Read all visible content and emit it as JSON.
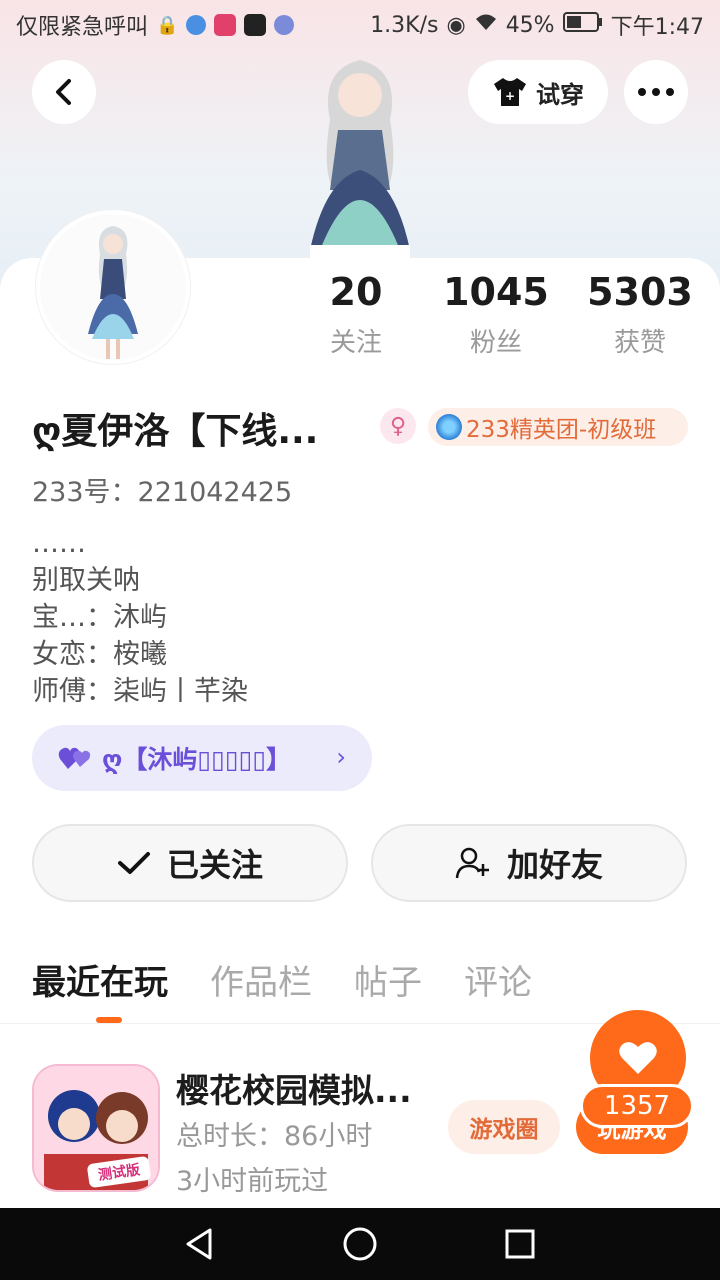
{
  "status_bar": {
    "carrier": "仅限紧急呼叫",
    "speed": "1.3K/s",
    "battery": "45%",
    "time": "下午1:47"
  },
  "header": {
    "tryon_label": "试穿"
  },
  "profile": {
    "stats": [
      {
        "value": "20",
        "label": "关注"
      },
      {
        "value": "1045",
        "label": "粉丝"
      },
      {
        "value": "5303",
        "label": "获赞"
      }
    ],
    "username": "ღ夏伊洛【下线...",
    "club_badge": "233精英团-初级班",
    "user_id": "233号：221042425",
    "bio": [
      "……",
      "别取关呐",
      "宝…：沐屿",
      "女恋：桉曦",
      "师傅：柒屿丨芊染"
    ],
    "cp_label": "ღ【沐屿▯▯▯▯▯】"
  },
  "actions": {
    "follow_label": "已关注",
    "friend_label": "加好友"
  },
  "tabs": [
    "最近在玩",
    "作品栏",
    "帖子",
    "评论"
  ],
  "recent_game": {
    "title": "樱花校园模拟...",
    "total_time": "总时长：86小时",
    "last_played": "3小时前玩过",
    "circle_label": "游戏圈",
    "play_label": "玩游戏",
    "icon_badge": "测试版"
  },
  "like_fab": {
    "count": "1357"
  },
  "colors": {
    "accent": "#ff6a1a",
    "purple": "#6b4fd9",
    "badge_bg": "#fdeee8"
  }
}
